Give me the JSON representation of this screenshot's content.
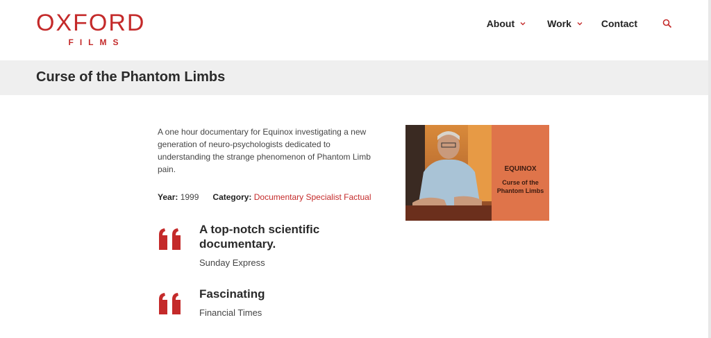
{
  "brand": {
    "main": "OXFORD",
    "sub": "FILMS"
  },
  "nav": {
    "about": "About",
    "work": "Work",
    "contact": "Contact",
    "search_icon": "search-icon"
  },
  "page": {
    "title": "Curse of the Phantom Limbs"
  },
  "film": {
    "description": "A one hour documentary for Equinox investigating a new generation of neuro-psychologists dedicated to understanding the strange phenomenon of Phantom Limb pain.",
    "year_label": "Year:",
    "year": "1999",
    "category_label": "Category:",
    "category": "Documentary Specialist Factual"
  },
  "quotes": [
    {
      "text": "A top-notch scientific documentary.",
      "source": "Sunday Express"
    },
    {
      "text": "Fascinating",
      "source": "Financial Times"
    }
  ],
  "poster": {
    "heading": "EQUINOX",
    "subtitle": "Curse of the Phantom Limbs"
  },
  "colors": {
    "accent": "#c42a2a",
    "title_bar": "#efefef",
    "poster_panel": "#df744a"
  }
}
